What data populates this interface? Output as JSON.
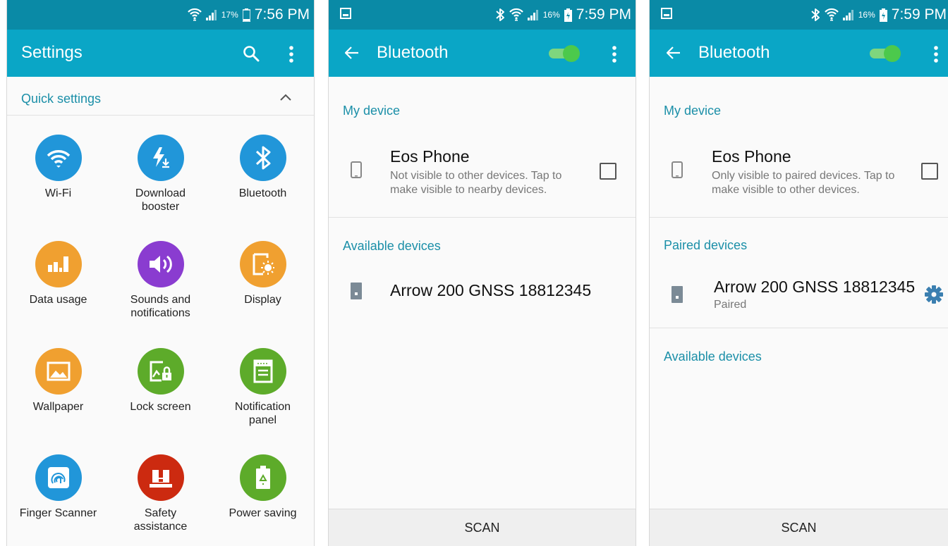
{
  "colors": {
    "statusbar": "#0a8aa6",
    "appbar": "#0aa6c6",
    "accent": "#1b8fa8",
    "toggle": "#4cc94c"
  },
  "screen1": {
    "status": {
      "battery": "17%",
      "time": "7:56 PM"
    },
    "title": "Settings",
    "icons": {
      "search": "search-icon",
      "more": "more-vert-icon"
    },
    "section": "Quick settings",
    "items": [
      {
        "label": "Wi-Fi",
        "icon": "wifi-icon",
        "color": "#2196d9"
      },
      {
        "label": "Download\nbooster",
        "icon": "download-booster-icon",
        "color": "#2196d9"
      },
      {
        "label": "Bluetooth",
        "icon": "bluetooth-icon",
        "color": "#2196d9"
      },
      {
        "label": "Data usage",
        "icon": "data-usage-icon",
        "color": "#f0a030"
      },
      {
        "label": "Sounds and\nnotifications",
        "icon": "volume-icon",
        "color": "#8a3cd0"
      },
      {
        "label": "Display",
        "icon": "display-icon",
        "color": "#f0a030"
      },
      {
        "label": "Wallpaper",
        "icon": "wallpaper-icon",
        "color": "#f0a030"
      },
      {
        "label": "Lock screen",
        "icon": "lock-screen-icon",
        "color": "#5dab2a"
      },
      {
        "label": "Notification\npanel",
        "icon": "notification-panel-icon",
        "color": "#5dab2a"
      },
      {
        "label": "Finger Scanner",
        "icon": "fingerprint-icon",
        "color": "#2196d9"
      },
      {
        "label": "Safety\nassistance",
        "icon": "safety-icon",
        "color": "#cc2a10"
      },
      {
        "label": "Power saving",
        "icon": "battery-recycle-icon",
        "color": "#5dab2a"
      }
    ]
  },
  "screen2": {
    "status": {
      "battery": "16%",
      "time": "7:59 PM"
    },
    "title": "Bluetooth",
    "toggle_on": true,
    "my_device_header": "My device",
    "device_name": "Eos Phone",
    "device_sub": "Not visible to other devices. Tap to make visible to nearby devices.",
    "available_header": "Available devices",
    "available": [
      {
        "name": "Arrow 200 GNSS 18812345"
      }
    ],
    "scan_label": "SCAN"
  },
  "screen3": {
    "status": {
      "battery": "16%",
      "time": "7:59 PM"
    },
    "title": "Bluetooth",
    "toggle_on": true,
    "my_device_header": "My device",
    "device_name": "Eos Phone",
    "device_sub": "Only visible to paired devices. Tap to make visible to other devices.",
    "paired_header": "Paired devices",
    "paired": [
      {
        "name": "Arrow 200 GNSS 18812345",
        "status": "Paired"
      }
    ],
    "available_header": "Available devices",
    "scan_label": "SCAN"
  }
}
